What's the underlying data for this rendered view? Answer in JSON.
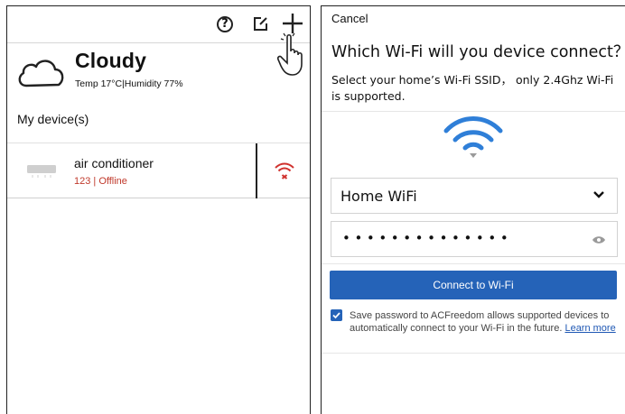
{
  "home": {
    "weather": {
      "condition": "Cloudy",
      "details": "Temp 17°C|Humidity 77%"
    },
    "devices_heading": "My device(s)",
    "device": {
      "name": "air conditioner",
      "status": "123 | Offline"
    },
    "icons": {
      "help": "?",
      "edit": "edit-icon",
      "add": "plus-icon",
      "pointer": "hand-pointer-icon",
      "weather": "cloud-icon",
      "device": "air-conditioner-icon",
      "connection": "wifi-off-icon"
    },
    "colors": {
      "offline": "#c0392b"
    }
  },
  "wifi_setup": {
    "cancel_label": "Cancel",
    "title": "Which Wi-Fi will you device connect？",
    "description": "Select your home’s Wi-Fi SSID， only 2.4Ghz Wi-Fi is supported.",
    "ssid_value": "Home WiFi",
    "password_mask": "••••••••••••••",
    "connect_label": "Connect to Wi-Fi",
    "save_password_text": "Save password to ACFreedom allows supported devices to automatically connect to your Wi-Fi in the future.",
    "learn_more_label": "Learn more",
    "colors": {
      "accent": "#2563b8",
      "wifi": "#2f7fd8"
    }
  }
}
